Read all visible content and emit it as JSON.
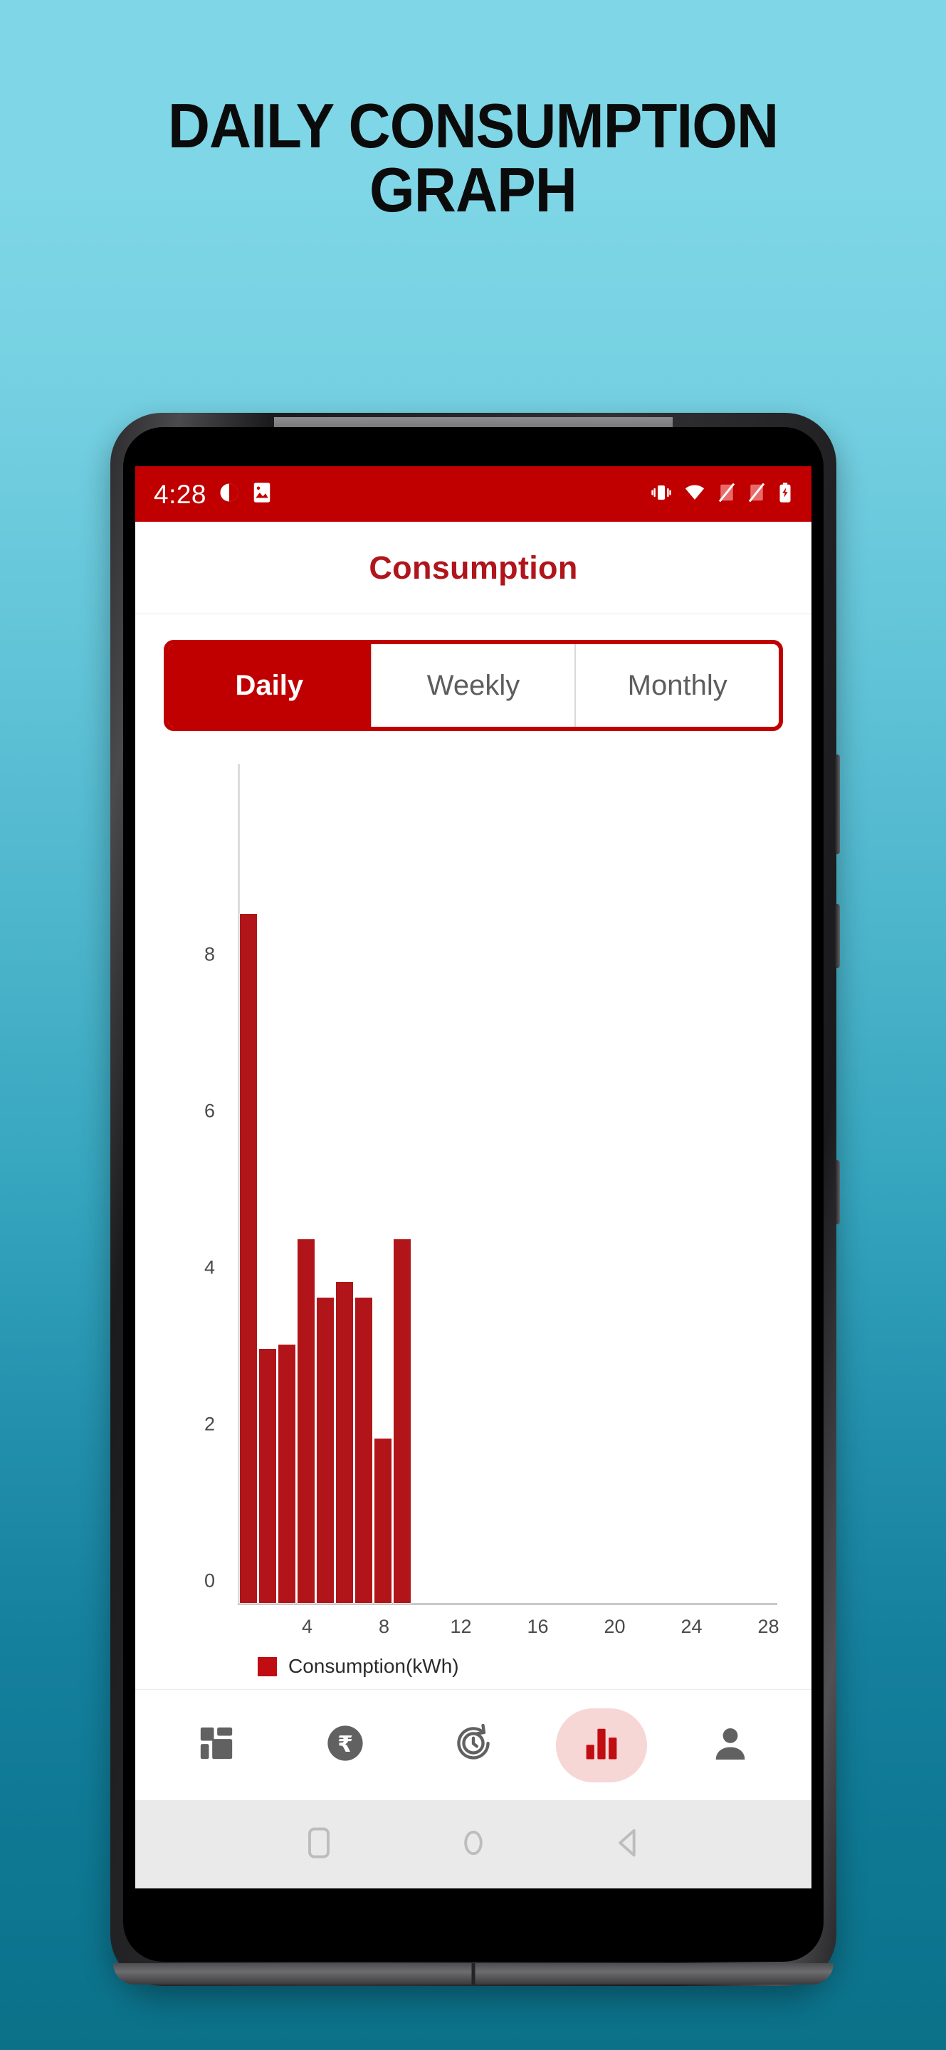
{
  "poster": {
    "title_line1": "DAILY CONSUMPTION",
    "title_line2": "GRAPH",
    "background_top": "#7ED6E6",
    "background_bottom": "#0B7189"
  },
  "status_bar": {
    "time": "4:28",
    "left_icons": [
      "do-not-disturb-icon",
      "image-icon"
    ],
    "right_icons": [
      "vibrate-icon",
      "wifi-icon",
      "signal-off-1-icon",
      "signal-off-2-icon",
      "battery-charging-icon"
    ],
    "background": "#C00000",
    "foreground": "#FFFFFF"
  },
  "app_bar": {
    "title": "Consumption",
    "title_color": "#B0151B"
  },
  "segmented_control": {
    "options": [
      {
        "label": "Daily",
        "selected": true
      },
      {
        "label": "Weekly",
        "selected": false
      },
      {
        "label": "Monthly",
        "selected": false
      }
    ],
    "accent": "#C00000"
  },
  "chart_data": {
    "type": "bar",
    "title": "",
    "xlabel": "",
    "ylabel": "",
    "x": [
      1,
      2,
      3,
      4,
      5,
      6,
      7,
      8,
      9
    ],
    "categories": [
      "1",
      "2",
      "3",
      "4",
      "5",
      "6",
      "7",
      "8",
      "9"
    ],
    "values": [
      8.8,
      3.25,
      3.3,
      4.65,
      3.9,
      4.1,
      3.9,
      2.1,
      4.65
    ],
    "series": [
      {
        "name": "Consumption(kWh)",
        "color": "#B11519",
        "values": [
          8.8,
          3.25,
          3.3,
          4.65,
          3.9,
          4.1,
          3.9,
          2.1,
          4.65
        ]
      }
    ],
    "ylim": [
      0,
      10
    ],
    "xlim": [
      0,
      31
    ],
    "yticks": [
      0,
      2,
      4,
      6,
      8
    ],
    "ytick_labels": [
      "0",
      "2",
      "4",
      "6",
      "8"
    ],
    "xticks": [
      4,
      8,
      12,
      16,
      20,
      24,
      28
    ],
    "xtick_labels": [
      "4",
      "8",
      "12",
      "16",
      "20",
      "24",
      "28"
    ],
    "grid": false,
    "legend": {
      "position": "bottom-left",
      "entries": [
        "Consumption(kWh)"
      ]
    },
    "bar_color": "#B11519"
  },
  "legend": {
    "label": "Consumption(kWh)",
    "swatch_color": "#C00D12"
  },
  "bottom_nav": {
    "items": [
      {
        "name": "dashboard",
        "icon": "dashboard-grid-icon",
        "active": false
      },
      {
        "name": "payments",
        "icon": "rupee-coin-icon",
        "active": false
      },
      {
        "name": "history",
        "icon": "history-clock-icon",
        "active": false
      },
      {
        "name": "analytics",
        "icon": "bar-chart-icon",
        "active": true
      },
      {
        "name": "profile",
        "icon": "person-icon",
        "active": false
      }
    ],
    "active_pill_color": "#F7D6D6",
    "active_icon_color": "#C00D12",
    "inactive_icon_color": "#616161"
  },
  "system_nav": {
    "buttons": [
      "recents-square-icon",
      "home-circle-icon",
      "back-triangle-icon"
    ],
    "background": "#EAEAEA"
  }
}
